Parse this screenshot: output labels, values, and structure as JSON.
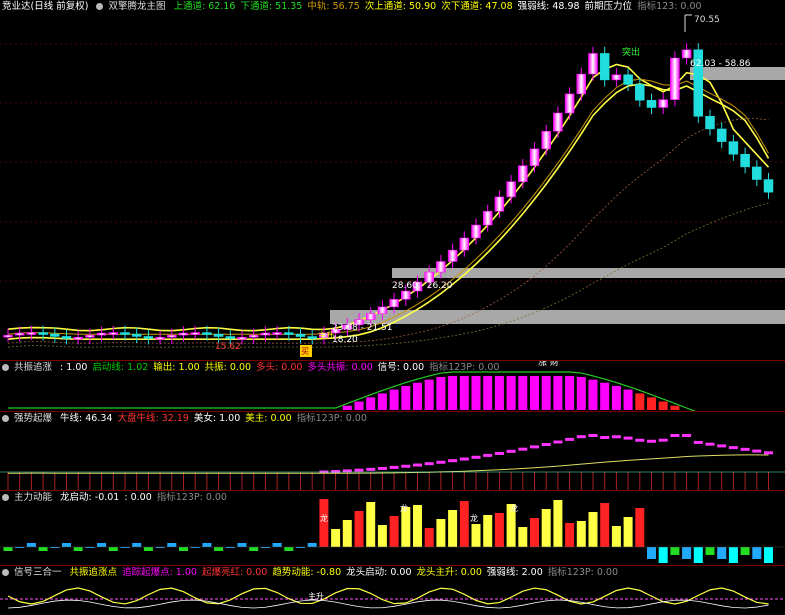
{
  "main": {
    "title": "竞业达(日线 前复权)",
    "indicator": "双擎腾龙主图",
    "items": [
      {
        "label": "上通道",
        "value": "62.16",
        "color": "#22dd22"
      },
      {
        "label": "下通道",
        "value": "51.35",
        "color": "#22dd22"
      },
      {
        "label": "中轨",
        "value": "56.75",
        "color": "#cc9900"
      },
      {
        "label": "次上通道",
        "value": "50.90",
        "color": "#ffff00"
      },
      {
        "label": "次下通道",
        "value": "47.08",
        "color": "#ffff00"
      },
      {
        "label": "强弱线",
        "value": "48.98",
        "color": "#ffffff"
      },
      {
        "label": "前期压力位",
        "value": "",
        "color": "#ffffff"
      },
      {
        "label": "指标123",
        "value": "0.00",
        "color": "#888888"
      }
    ],
    "annotations": {
      "high": "70.55",
      "band_right": "62.03 - 58.86",
      "band_mid": "28.60 - 26.20",
      "band_low": "23.88 - 21.51",
      "low_val": "18.20",
      "low_left": "15.62",
      "tag_top": "突出",
      "tag_mid": "主升",
      "tag_bottom": "买"
    }
  },
  "pane1": {
    "name": "共振追涨",
    "items": [
      {
        "label": "",
        "value": "1.00",
        "color": "#ffffff"
      },
      {
        "label": "启动线",
        "value": "1.02",
        "color": "#00cc00"
      },
      {
        "label": "输出",
        "value": "1.00",
        "color": "#ffff00"
      },
      {
        "label": "共振",
        "value": "0.00",
        "color": "#ffff00"
      },
      {
        "label": "多头",
        "value": "0.00",
        "color": "#ff3333"
      },
      {
        "label": "多头共振",
        "value": "0.00",
        "color": "#ff00ff"
      },
      {
        "label": "信号",
        "value": "0.00",
        "color": "#ffffff"
      },
      {
        "label": "指标123P",
        "value": "0.00",
        "color": "#888888"
      }
    ],
    "marker": "涨 财"
  },
  "pane2": {
    "name": "强势起爆",
    "items": [
      {
        "label": "牛线",
        "value": "46.34",
        "color": "#ffffff"
      },
      {
        "label": "大盘牛线",
        "value": "32.19",
        "color": "#ff3333"
      },
      {
        "label": "美女",
        "value": "1.00",
        "color": "#ffffff"
      },
      {
        "label": "美主",
        "value": "0.00",
        "color": "#ffff00"
      },
      {
        "label": "指标123P",
        "value": "0.00",
        "color": "#888888"
      }
    ]
  },
  "pane3": {
    "name": "主力动能",
    "items": [
      {
        "label": "龙启动",
        "value": "-0.01",
        "color": "#ffffff"
      },
      {
        "label": "",
        "value": "0.00",
        "color": "#ffffff"
      },
      {
        "label": "指标123P",
        "value": "0.00",
        "color": "#888888"
      }
    ],
    "labels": [
      "龙",
      "龙",
      "龙",
      "龙"
    ]
  },
  "pane4": {
    "name": "信号三合一",
    "items": [
      {
        "label": "共振追涨点",
        "value": "",
        "color": "#ffff00"
      },
      {
        "label": "追踪起爆点",
        "value": "1.00",
        "color": "#ff00ff"
      },
      {
        "label": "起爆亮红",
        "value": "0.00",
        "color": "#ff3333"
      },
      {
        "label": "趋势动能",
        "value": "-0.80",
        "color": "#ffff00"
      },
      {
        "label": "龙头启动",
        "value": "0.00",
        "color": "#ffffff"
      },
      {
        "label": "龙头主升",
        "value": "0.00",
        "color": "#ffff00"
      },
      {
        "label": "强弱线",
        "value": "2.00",
        "color": "#ffffff"
      },
      {
        "label": "指标123P",
        "value": "0.00",
        "color": "#888888"
      }
    ],
    "bottom_label": "主升"
  },
  "colors": {
    "up": "#ff00ff",
    "down": "#22dddd",
    "yellow": "#ffff00",
    "grid": "#7a0000"
  }
}
